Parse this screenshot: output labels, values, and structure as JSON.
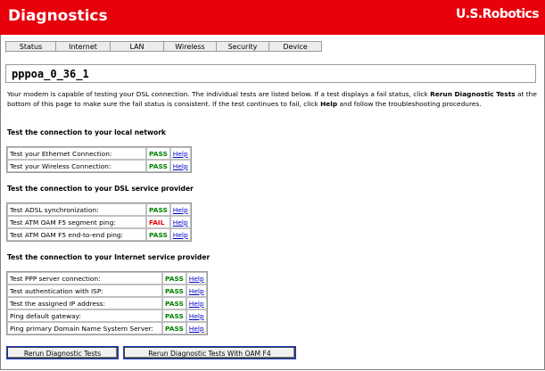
{
  "header": {
    "title": "Diagnostics",
    "brand": "U.S.Robotics",
    "brand_color": "#e8000b"
  },
  "tabs": [
    "Status",
    "Internet",
    "LAN",
    "Wireless",
    "Security",
    "Device"
  ],
  "connection_name": "pppoa_0_36_1",
  "intro": {
    "part1": "Your modem is capable of testing your DSL connection. The individual tests are listed below. If a test displays a fail status, click ",
    "rerun_bold": "Rerun Diagnostic Tests",
    "part2": " at the bottom of this page to make sure the fail status is consistent. If the test continues to fail, click ",
    "help_bold": "Help",
    "part3": " and follow the troubleshooting procedures."
  },
  "sections": [
    {
      "title": "Test the connection to your local network",
      "tests": [
        {
          "label": "Test your Ethernet Connection:",
          "status": "PASS",
          "help": "Help"
        },
        {
          "label": "Test your Wireless Connection:",
          "status": "PASS",
          "help": "Help"
        }
      ]
    },
    {
      "title": "Test the connection to your DSL service provider",
      "tests": [
        {
          "label": "Test ADSL synchronization:",
          "status": "PASS",
          "help": "Help"
        },
        {
          "label": "Test ATM OAM F5 segment ping:",
          "status": "FAIL",
          "help": "Help"
        },
        {
          "label": "Test ATM OAM F5 end-to-end ping:",
          "status": "PASS",
          "help": "Help"
        }
      ]
    },
    {
      "title": "Test the connection to your Internet service provider",
      "tests": [
        {
          "label": "Test PPP server connection:",
          "status": "PASS",
          "help": "Help"
        },
        {
          "label": "Test authentication with ISP:",
          "status": "PASS",
          "help": "Help"
        },
        {
          "label": "Test the assigned IP address:",
          "status": "PASS",
          "help": "Help"
        },
        {
          "label": "Ping default gateway:",
          "status": "PASS",
          "help": "Help"
        },
        {
          "label": "Ping primary Domain Name System Server:",
          "status": "PASS",
          "help": "Help"
        }
      ]
    }
  ],
  "buttons": {
    "rerun": "Rerun Diagnostic Tests",
    "rerun_oam": "Rerun Diagnostic Tests With OAM F4"
  },
  "status_colors": {
    "pass": "#008000",
    "fail": "#e00000"
  }
}
